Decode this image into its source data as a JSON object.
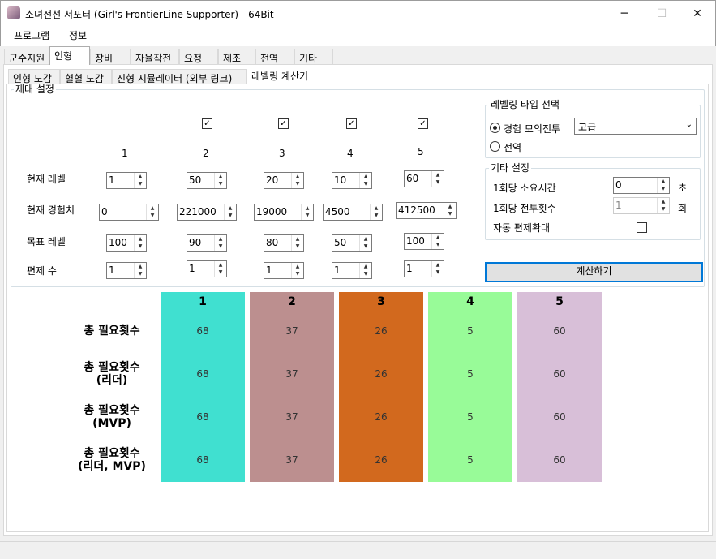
{
  "window": {
    "title": "소녀전선 서포터 (Girl's FrontierLine Supporter) - 64Bit",
    "minimize": "─",
    "maximize": "☐",
    "close": "✕"
  },
  "menu": [
    "프로그램",
    "정보"
  ],
  "tabs": [
    "군수지원",
    "인형",
    "장비",
    "자율작전",
    "요정",
    "제조",
    "전역",
    "기타"
  ],
  "subtabs": [
    "인형 도감",
    "혈혈 도감",
    "진형 시뮬레이터 (외부 링크)",
    "레벨링 계산기"
  ],
  "echelon": {
    "group_label": "제대 설정",
    "numbers": [
      "1",
      "2",
      "3",
      "4",
      "5"
    ],
    "row_labels": [
      "현재 레벨",
      "현재 경험치",
      "목표 레벨",
      "편제 수"
    ],
    "checkbox_mark": "✓",
    "current_level": [
      "1",
      "50",
      "20",
      "10",
      "60"
    ],
    "current_exp": [
      "0",
      "221000",
      "19000",
      "4500",
      "412500"
    ],
    "target_level": [
      "100",
      "90",
      "80",
      "50",
      "100"
    ],
    "formation": [
      "1",
      "1",
      "1",
      "1",
      "1"
    ]
  },
  "leveling": {
    "group_label": "레벨링 타입 선택",
    "opt1": "경험 모의전투",
    "opt2": "전역",
    "difficulty": "고급"
  },
  "other": {
    "group_label": "기타 설정",
    "time_label": "1회당 소요시간",
    "time_value": "0",
    "time_unit": "초",
    "battle_label": "1회당 전투횟수",
    "battle_value": "1",
    "battle_unit": "회",
    "auto_label": "자동 편제확대"
  },
  "calc_button": "계산하기",
  "results": {
    "row_labels": [
      [
        "총 필요횟수"
      ],
      [
        "총 필요횟수",
        "(리더)"
      ],
      [
        "총 필요횟수",
        "(MVP)"
      ],
      [
        "총 필요횟수",
        "(리더, MVP)"
      ]
    ],
    "columns": [
      {
        "num": "1",
        "color": "#40e0d0",
        "values": [
          "68",
          "68",
          "68",
          "68"
        ]
      },
      {
        "num": "2",
        "color": "#bc8f8f",
        "values": [
          "37",
          "37",
          "37",
          "37"
        ]
      },
      {
        "num": "3",
        "color": "#d2691e",
        "values": [
          "26",
          "26",
          "26",
          "26"
        ]
      },
      {
        "num": "4",
        "color": "#98fb98",
        "values": [
          "5",
          "5",
          "5",
          "5"
        ]
      },
      {
        "num": "5",
        "color": "#d8bfd8",
        "values": [
          "60",
          "60",
          "60",
          "60"
        ]
      }
    ]
  }
}
